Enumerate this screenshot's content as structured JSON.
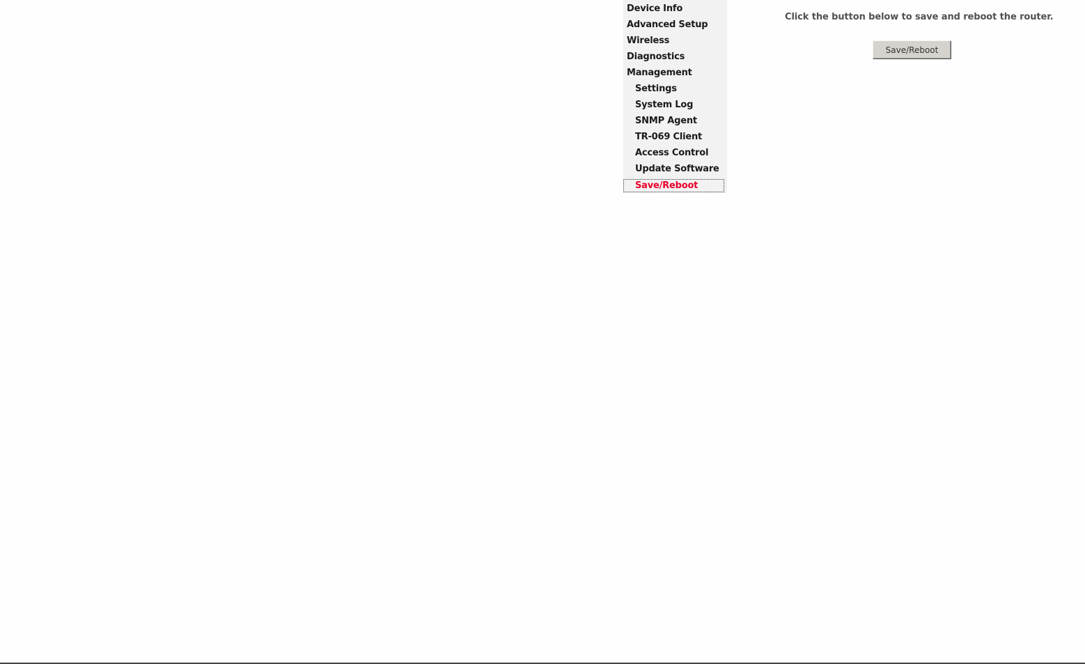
{
  "sidebar": {
    "items": [
      {
        "label": "Device Info"
      },
      {
        "label": "Advanced Setup"
      },
      {
        "label": "Wireless"
      },
      {
        "label": "Diagnostics"
      },
      {
        "label": "Management"
      },
      {
        "label": "Settings"
      },
      {
        "label": "System Log"
      },
      {
        "label": "SNMP Agent"
      },
      {
        "label": "TR-069 Client"
      },
      {
        "label": "Access Control"
      },
      {
        "label": "Update Software"
      },
      {
        "label": "Save/Reboot"
      }
    ],
    "active_color": "#e8002a"
  },
  "main": {
    "instruction": "Click the button below to save and reboot the router.",
    "button_label": "Save/Reboot"
  }
}
